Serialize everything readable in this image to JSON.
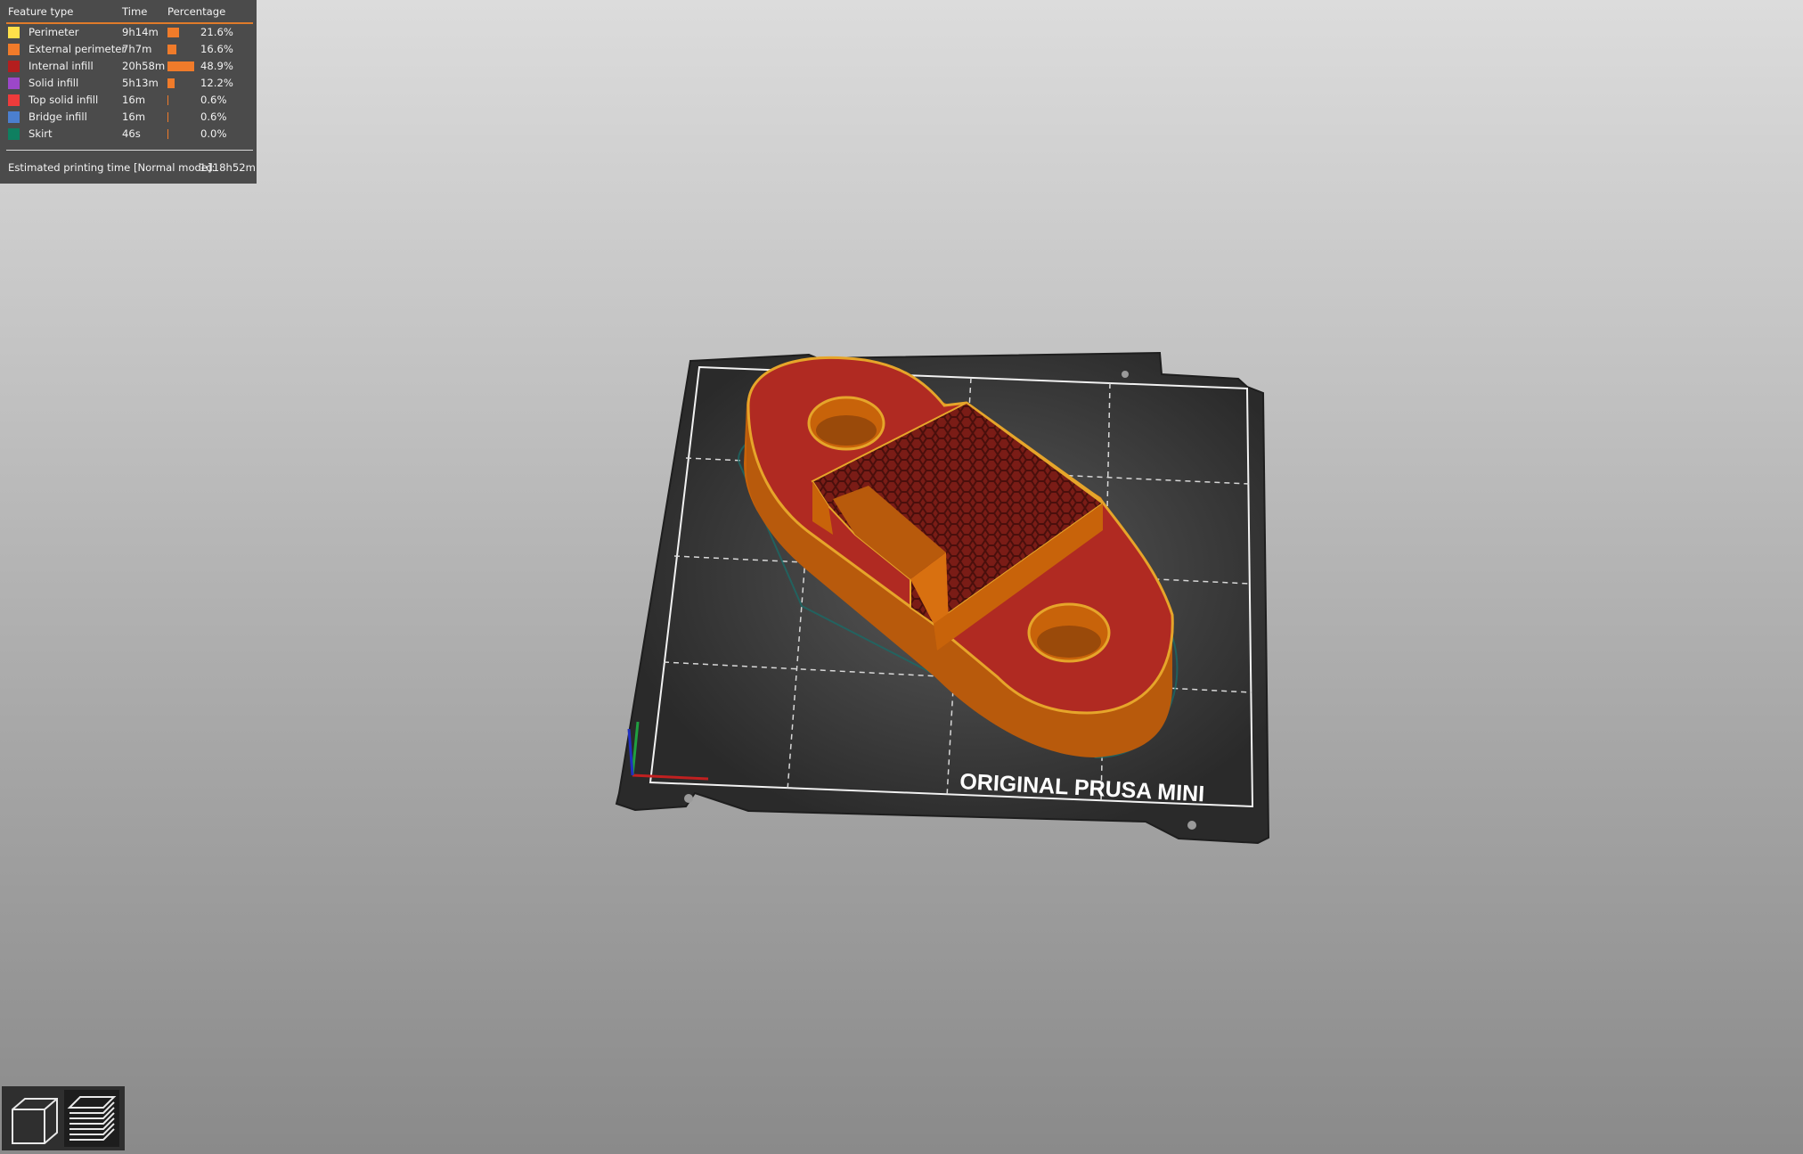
{
  "legend": {
    "headers": {
      "feature": "Feature type",
      "time": "Time",
      "percentage": "Percentage"
    },
    "rows": [
      {
        "name": "Perimeter",
        "time": "9h14m",
        "percent": "21.6%",
        "fraction": 0.216,
        "color": "#ffe04a"
      },
      {
        "name": "External perimeter",
        "time": "7h7m",
        "percent": "16.6%",
        "fraction": 0.166,
        "color": "#f07b2a"
      },
      {
        "name": "Internal infill",
        "time": "20h58m",
        "percent": "48.9%",
        "fraction": 0.489,
        "color": "#b41e1e"
      },
      {
        "name": "Solid infill",
        "time": "5h13m",
        "percent": "12.2%",
        "fraction": 0.122,
        "color": "#9c47c9"
      },
      {
        "name": "Top solid infill",
        "time": "16m",
        "percent": "0.6%",
        "fraction": 0.006,
        "color": "#ef3b3b"
      },
      {
        "name": "Bridge infill",
        "time": "16m",
        "percent": "0.6%",
        "fraction": 0.006,
        "color": "#4b7fcf"
      },
      {
        "name": "Skirt",
        "time": "46s",
        "percent": "0.0%",
        "fraction": 0.0,
        "color": "#0f7f60"
      }
    ],
    "estimate_label": "Estimated printing time [Normal mode]:",
    "estimate_value": "1d18h52m"
  },
  "bed": {
    "label": "ORIGINAL PRUSA MINI"
  },
  "view_buttons": {
    "icons": [
      "3d-view-icon",
      "preview-layers-icon"
    ]
  },
  "colors": {
    "accent": "#f07b2a",
    "model_top": "#b02a22",
    "model_side": "#c8630a",
    "perimeter": "#e6a52a",
    "bed": "#333333"
  }
}
